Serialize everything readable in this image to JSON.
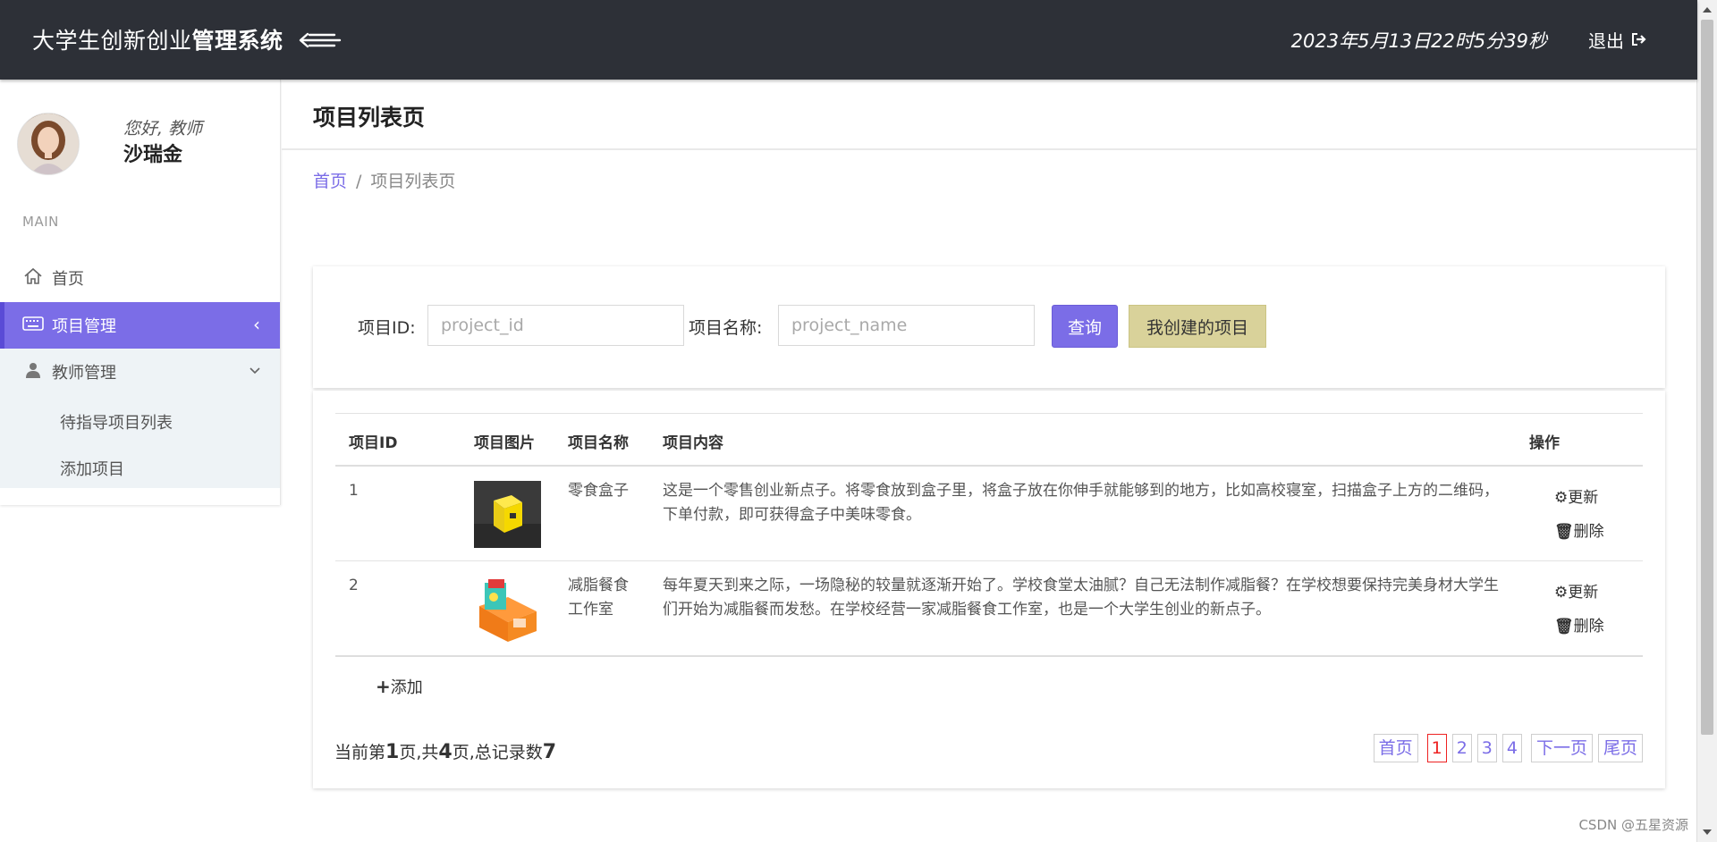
{
  "header": {
    "brand_part1": "大学生创新创业",
    "brand_part2": "管理系统",
    "datetime": "2023年5月13日22时5分39秒",
    "logout_label": "退出"
  },
  "user": {
    "greeting": "您好, 教师",
    "name": "沙瑞金"
  },
  "sidebar": {
    "section_label": "MAIN",
    "items": [
      {
        "label": "首页"
      },
      {
        "label": "项目管理"
      },
      {
        "label": "教师管理"
      }
    ],
    "subitems": [
      {
        "label": "待指导项目列表"
      },
      {
        "label": "添加项目"
      }
    ]
  },
  "page": {
    "title": "项目列表页",
    "breadcrumb_home": "首页",
    "breadcrumb_separator": "/",
    "breadcrumb_current": "项目列表页"
  },
  "search": {
    "id_label": "项目ID:",
    "id_placeholder": "project_id",
    "name_label": "项目名称:",
    "name_placeholder": "project_name",
    "query_button": "查询",
    "mine_button": "我创建的项目"
  },
  "table": {
    "columns": [
      "项目ID",
      "项目图片",
      "项目名称",
      "项目内容",
      "操作"
    ],
    "rows": [
      {
        "id": "1",
        "name": "零食盒子",
        "content": "这是一个零售创业新点子。将零食放到盒子里，将盒子放在你伸手就能够到的地方，比如高校寝室，扫描盒子上方的二维码，下单付款，即可获得盒子中美味零食。"
      },
      {
        "id": "2",
        "name": "减脂餐食工作室",
        "content": "每年夏天到来之际，一场隐秘的较量就逐渐开始了。学校食堂太油腻？自己无法制作减脂餐？在学校想要保持完美身材大学生们开始为减脂餐而发愁。在学校经营一家减脂餐食工作室，也是一个大学生创业的新点子。"
      }
    ],
    "update_label": "更新",
    "delete_label": "删除",
    "add_label": "添加"
  },
  "pagination": {
    "summary_prefix": "当前第",
    "current_page": "1",
    "summary_mid1": "页,共",
    "total_pages": "4",
    "summary_mid2": "页,总记录数",
    "total_records": "7",
    "first": "首页",
    "pages": [
      "1",
      "2",
      "3",
      "4"
    ],
    "next": "下一页",
    "last": "尾页"
  },
  "watermark": "CSDN @五星资源",
  "colors": {
    "accent": "#7b6de7",
    "header_bg": "#2d3037",
    "mine_button_bg": "#d9d29a",
    "current_page": "#e22222"
  }
}
